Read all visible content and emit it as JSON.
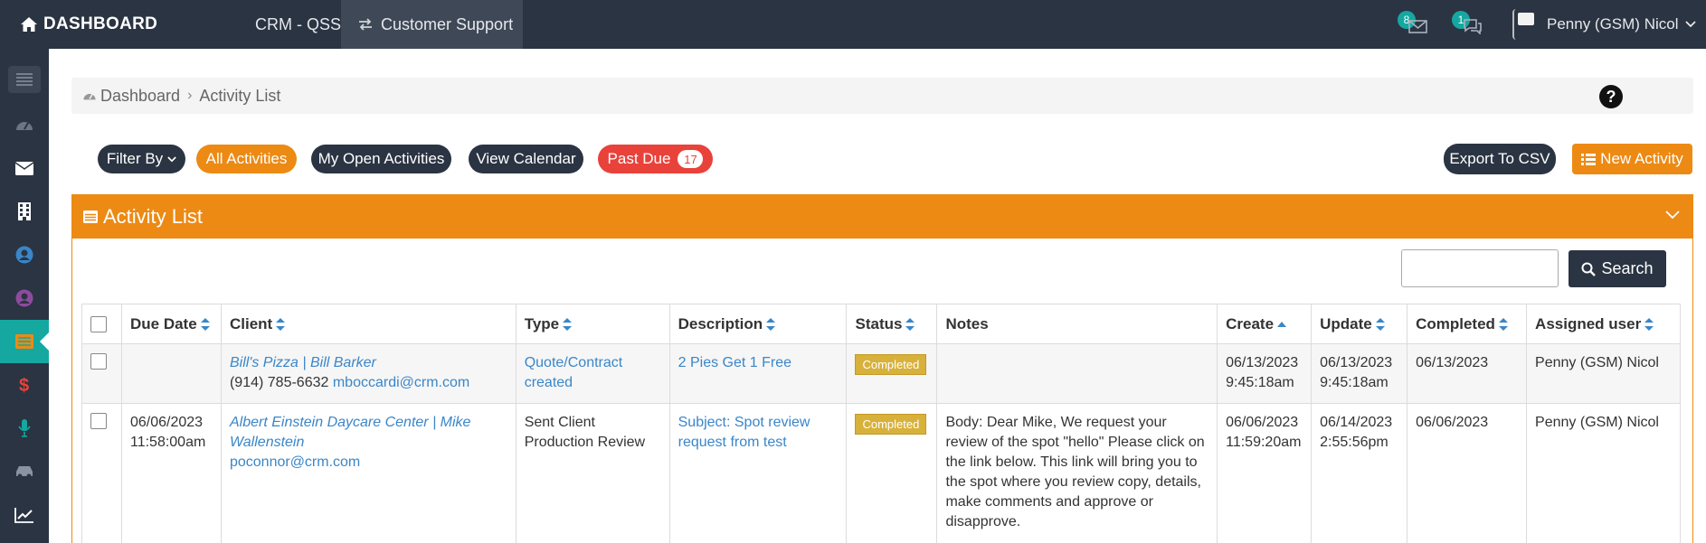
{
  "topbar": {
    "brand": "DASHBOARD",
    "nav": {
      "crm": "CRM - QSSS",
      "support": "Customer Support"
    },
    "notifications": {
      "messages": "8",
      "chats": "1"
    },
    "user_name": "Penny (GSM) Nicol"
  },
  "breadcrumb": {
    "home": "Dashboard",
    "current": "Activity List",
    "help": "?"
  },
  "filters": {
    "filter_by": "Filter By",
    "all": "All Activities",
    "my_open": "My Open Activities",
    "calendar": "View Calendar",
    "past_due": "Past Due",
    "past_due_count": "17",
    "export": "Export To CSV",
    "new_activity": "New Activity"
  },
  "panel": {
    "title": "Activity List",
    "search_label": "Search",
    "search_value": ""
  },
  "table": {
    "headers": {
      "due_date": "Due Date",
      "client": "Client",
      "type": "Type",
      "description": "Description",
      "status": "Status",
      "notes": "Notes",
      "create": "Create",
      "update": "Update",
      "completed": "Completed",
      "assigned": "Assigned user"
    },
    "rows": [
      {
        "due_date": "",
        "due_time": "",
        "client_name": "Bill's Pizza | Bill Barker",
        "client_phone": "(914) 785-6632",
        "client_email": "mboccardi@crm.com",
        "type": "Quote/Contract created",
        "description": "2 Pies Get 1 Free",
        "status": "Completed",
        "notes": "",
        "create_date": "06/13/2023",
        "create_time": "9:45:18am",
        "update_date": "06/13/2023",
        "update_time": "9:45:18am",
        "completed": "06/13/2023",
        "assigned": "Penny (GSM) Nicol"
      },
      {
        "due_date": "06/06/2023",
        "due_time": "11:58:00am",
        "client_name": "Albert Einstein Daycare Center | Mike Wallenstein",
        "client_phone": "",
        "client_email": "poconnor@crm.com",
        "type": "Sent Client Production Review",
        "description": "Subject: Spot review request from test",
        "status": "Completed",
        "notes": "Body: Dear Mike, We request your review of the spot \"hello\" Please click on the link below. This link will bring you to the spot where you review copy, details, make comments and approve or disapprove.",
        "create_date": "06/06/2023",
        "create_time": "11:59:20am",
        "update_date": "06/14/2023",
        "update_time": "2:55:56pm",
        "completed": "06/06/2023",
        "assigned": "Penny (GSM) Nicol"
      }
    ]
  },
  "colors": {
    "navy": "#2b3442",
    "orange": "#ec8a14",
    "teal": "#14a8a0",
    "red": "#e9423a",
    "link": "#3a86c8",
    "status": "#d8b13b"
  }
}
